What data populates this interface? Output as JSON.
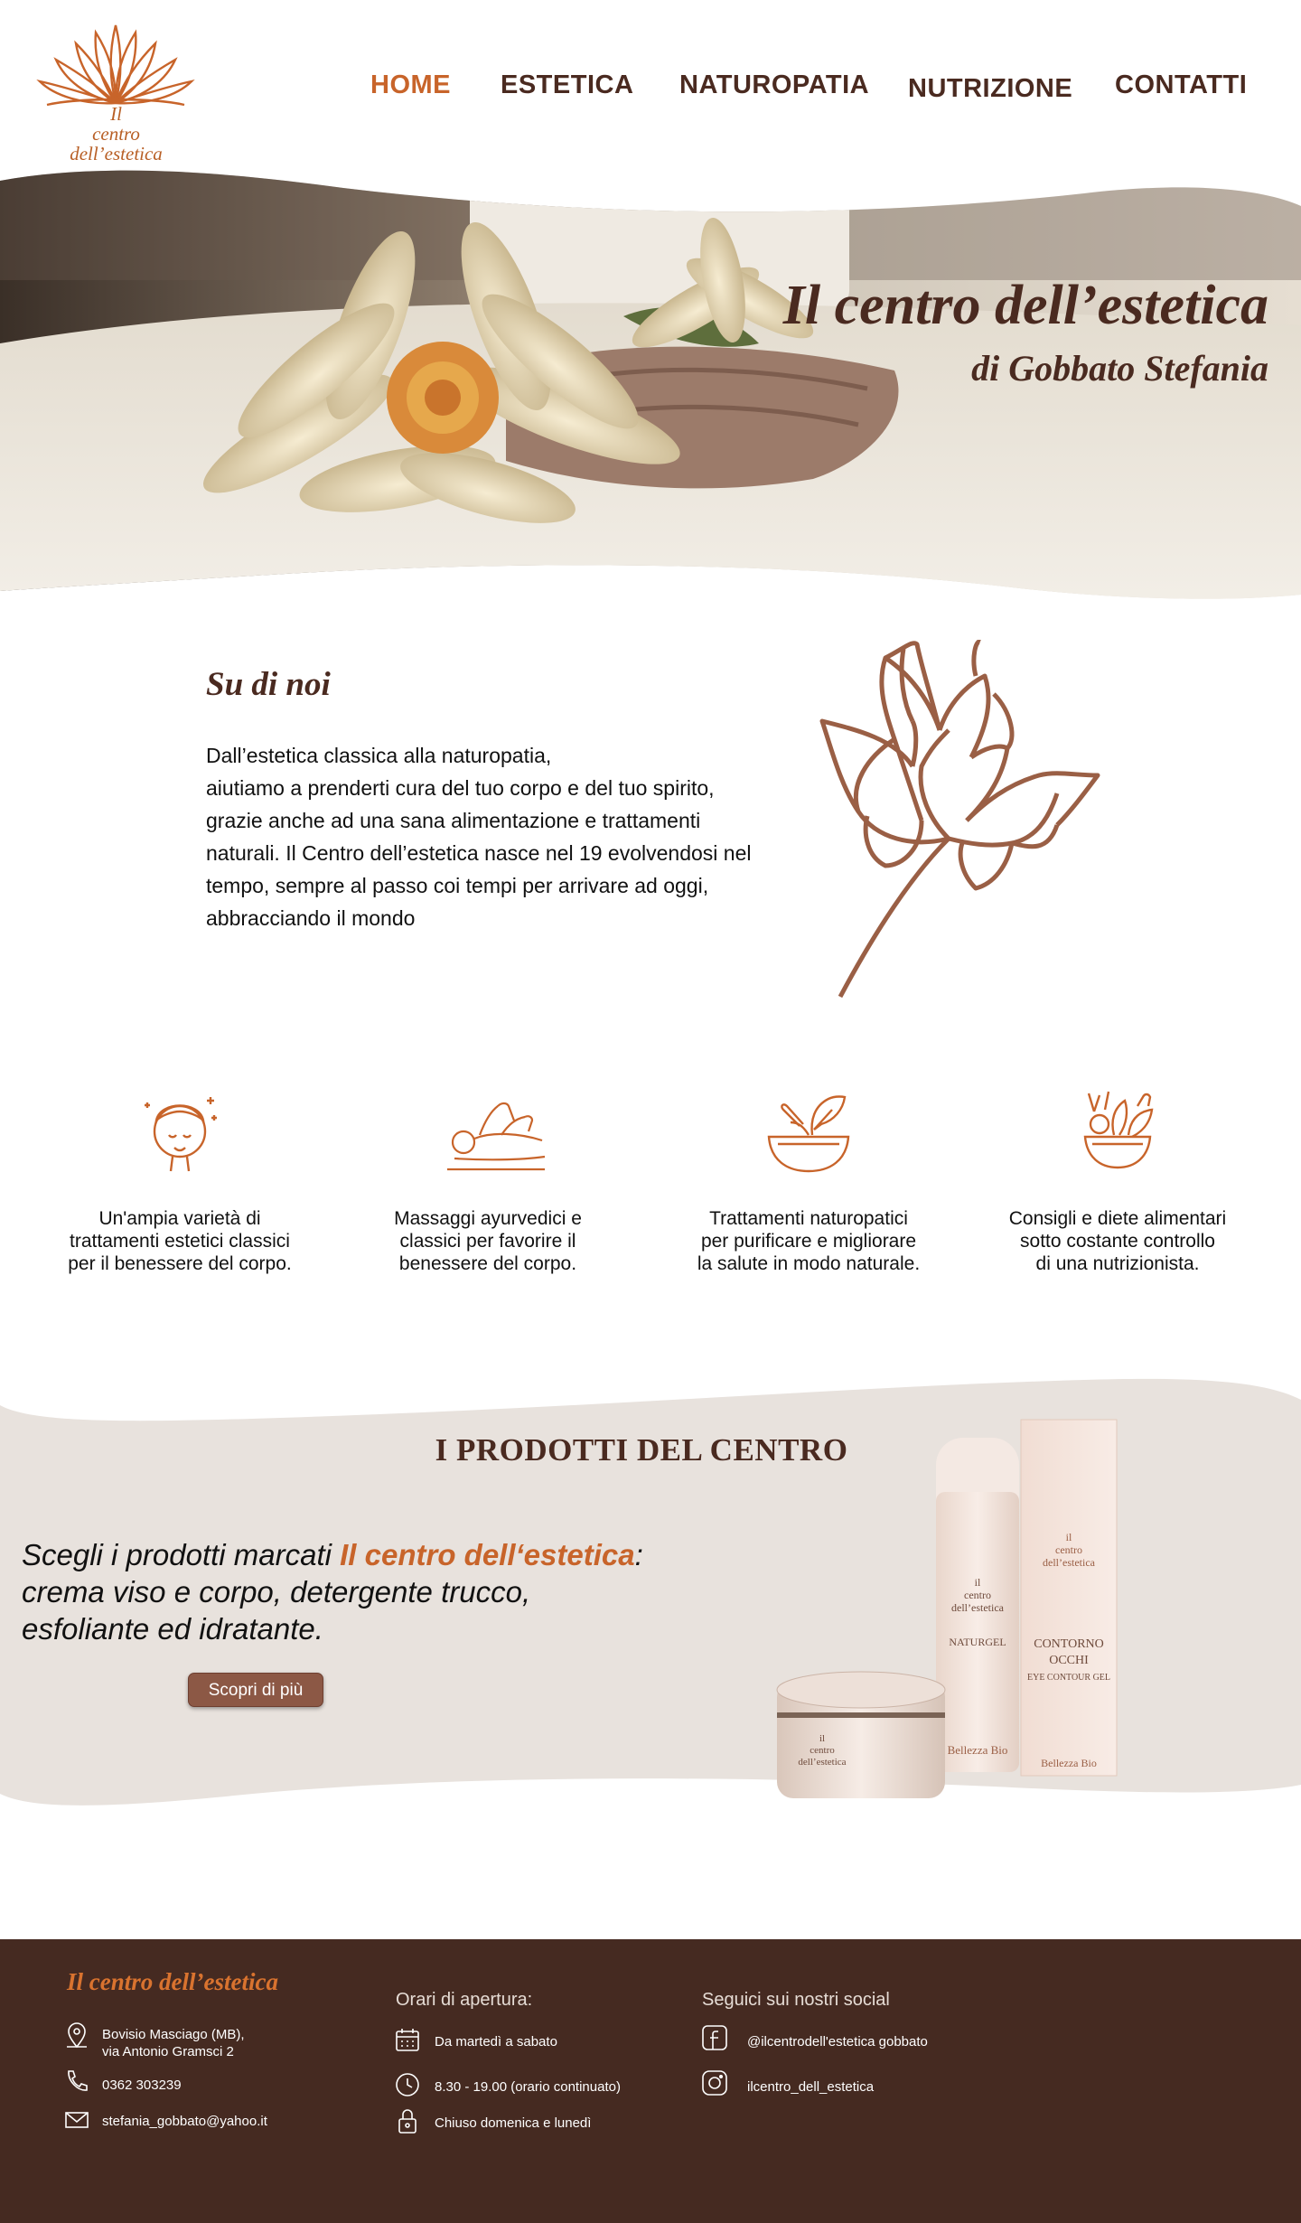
{
  "logo": {
    "line1": "Il",
    "line2": "centro",
    "line3": "dell’estetica"
  },
  "nav": {
    "items": [
      {
        "label": "HOME",
        "active": true
      },
      {
        "label": "ESTETICA",
        "active": false
      },
      {
        "label": "NATUROPATIA",
        "active": false
      },
      {
        "label": "NUTRIZIONE",
        "active": false
      },
      {
        "label": "CONTATTI",
        "active": false
      }
    ]
  },
  "hero": {
    "title": "Il centro dell’estetica",
    "subtitle": "di Gobbato Stefania"
  },
  "about": {
    "title": "Su di noi",
    "lines": [
      "Dall’estetica classica alla naturopatia,",
      "aiutiamo a prenderti cura del tuo corpo e del tuo spirito,",
      "grazie anche ad una sana alimentazione e trattamenti",
      "naturali. Il Centro dell’estetica nasce nel 19 evolvendosi nel",
      "tempo, sempre al passo coi tempi per arrivare ad oggi,",
      "abbracciando il mondo"
    ]
  },
  "features": [
    {
      "icon": "face-care-icon",
      "lines": [
        "Un'ampia varietà di",
        "trattamenti estetici classici",
        "per il benessere del corpo."
      ]
    },
    {
      "icon": "massage-icon",
      "lines": [
        "Massaggi ayurvedici e",
        "classici per favorire il",
        "benessere del corpo."
      ]
    },
    {
      "icon": "mortar-herbs-icon",
      "lines": [
        "Trattamenti naturopatici",
        "per purificare e migliorare",
        "la salute in modo naturale."
      ]
    },
    {
      "icon": "salad-bowl-icon",
      "lines": [
        "Consigli e diete alimentari",
        "sotto costante controllo",
        "di una nutrizionista."
      ]
    }
  ],
  "products": {
    "title": "I PRODOTTI DEL CENTRO",
    "text_before": "Scegli i prodotti marcati ",
    "text_highlight": "Il centro dell‘estetica",
    "text_after": ": crema viso e corpo, detergente trucco, esfoliante ed idratante.",
    "button_label": "Scopri di più"
  },
  "footer": {
    "brand": "Il centro dell’estetica",
    "address_line1": "Bovisio Masciago (MB),",
    "address_line2": "via Antonio Gramsci 2",
    "phone": "0362 303239",
    "email": "stefania_gobbato@yahoo.it",
    "hours_title": "Orari di apertura:",
    "hours_days": "Da martedì a sabato",
    "hours_time": "8.30 - 19.00 (orario continuato)",
    "hours_closed": "Chiuso domenica e lunedì",
    "social_title": "Seguici sui nostri social",
    "facebook": "@ilcentrodell'estetica gobbato",
    "instagram": "ilcentro_dell_estetica"
  },
  "colors": {
    "accent": "#c8642a",
    "brown": "#4a2a20",
    "footer_bg": "#452a21",
    "band": "#e8e2dd"
  }
}
